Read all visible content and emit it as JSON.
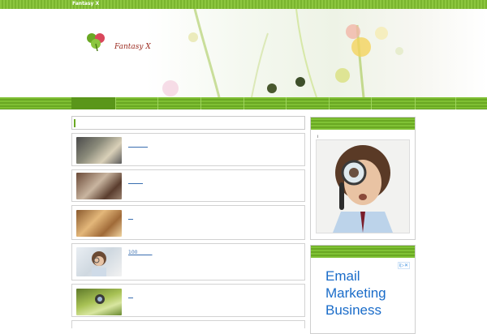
{
  "site": {
    "name": "Fantasy X",
    "logo_text": "Fantasy X"
  },
  "colors": {
    "accent_green": "#7ab52f",
    "nav_active": "#5a961a",
    "link_blue": "#3a6fb0",
    "ad_blue": "#1a6cc9"
  },
  "icons": {
    "logo": "clover-icon",
    "ad_choices": "adchoices-icon"
  },
  "nav": {
    "item_count": 10,
    "active_index": 0
  },
  "search": {
    "placeholder": ""
  },
  "posts": [
    {
      "title": "________",
      "thumb": "camera-gear"
    },
    {
      "title": "______",
      "thumb": "dolls"
    },
    {
      "title": "__",
      "thumb": "toys"
    },
    {
      "title": "100______",
      "thumb": "man-magnifier"
    },
    {
      "title": "__",
      "thumb": "green-ball"
    }
  ],
  "sidebar": {
    "profile_note": "i",
    "ad": {
      "lines": [
        "Email",
        "Marketing",
        "Business"
      ],
      "info_label": "i▷✕"
    }
  }
}
